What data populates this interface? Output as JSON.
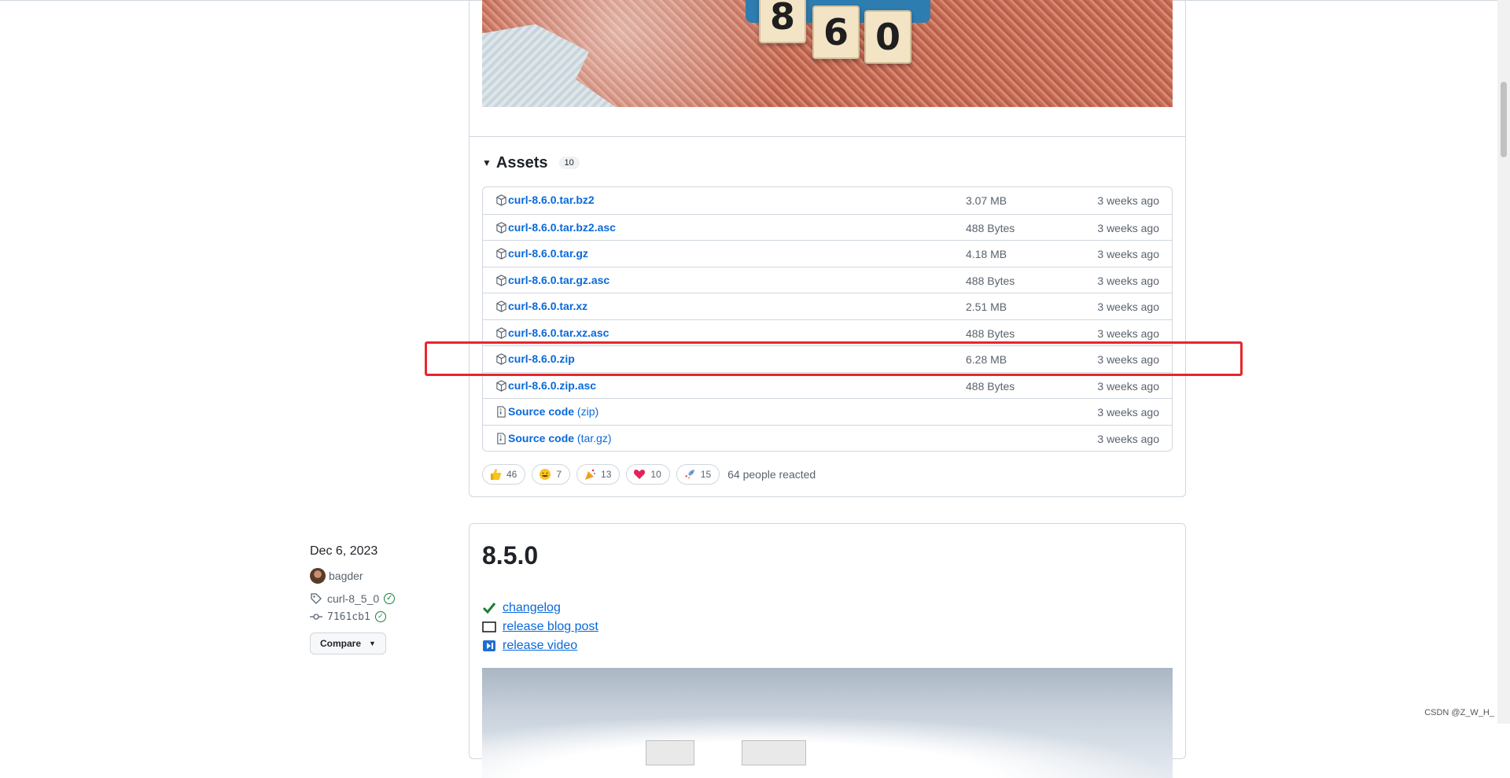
{
  "assets": {
    "title": "Assets",
    "count": "10",
    "items": [
      {
        "name": "curl-8.6.0.tar.bz2",
        "paren": "",
        "size": "3.07 MB",
        "date": "3 weeks ago",
        "icon": "package-icon"
      },
      {
        "name": "curl-8.6.0.tar.bz2.asc",
        "paren": "",
        "size": "488 Bytes",
        "date": "3 weeks ago",
        "icon": "package-icon"
      },
      {
        "name": "curl-8.6.0.tar.gz",
        "paren": "",
        "size": "4.18 MB",
        "date": "3 weeks ago",
        "icon": "package-icon"
      },
      {
        "name": "curl-8.6.0.tar.gz.asc",
        "paren": "",
        "size": "488 Bytes",
        "date": "3 weeks ago",
        "icon": "package-icon"
      },
      {
        "name": "curl-8.6.0.tar.xz",
        "paren": "",
        "size": "2.51 MB",
        "date": "3 weeks ago",
        "icon": "package-icon"
      },
      {
        "name": "curl-8.6.0.tar.xz.asc",
        "paren": "",
        "size": "488 Bytes",
        "date": "3 weeks ago",
        "icon": "package-icon"
      },
      {
        "name": "curl-8.6.0.zip",
        "paren": "",
        "size": "6.28 MB",
        "date": "3 weeks ago",
        "icon": "package-icon"
      },
      {
        "name": "curl-8.6.0.zip.asc",
        "paren": "",
        "size": "488 Bytes",
        "date": "3 weeks ago",
        "icon": "package-icon"
      },
      {
        "name": "Source code",
        "paren": "(zip)",
        "size": "",
        "date": "3 weeks ago",
        "icon": "file-zip-icon"
      },
      {
        "name": "Source code",
        "paren": "(tar.gz)",
        "size": "",
        "date": "3 weeks ago",
        "icon": "file-zip-icon"
      }
    ]
  },
  "reactions": {
    "items": [
      {
        "emoji": "thumbs-up-icon",
        "count": "46"
      },
      {
        "emoji": "laugh-icon",
        "count": "7"
      },
      {
        "emoji": "hooray-icon",
        "count": "13"
      },
      {
        "emoji": "heart-icon",
        "count": "10"
      },
      {
        "emoji": "rocket-icon",
        "count": "15"
      }
    ],
    "summary": "64 people reacted"
  },
  "hero1": {
    "tiles": [
      "8",
      "6",
      "0"
    ]
  },
  "release2": {
    "date": "Dec 6, 2023",
    "author": "bagder",
    "tag": "curl-8_5_0",
    "commit": "7161cb1",
    "compare_label": "Compare",
    "title": "8.5.0",
    "links": [
      {
        "icon": "check-mark-icon",
        "label": "changelog"
      },
      {
        "icon": "book-icon",
        "label": "release blog post"
      },
      {
        "icon": "play-video-icon",
        "label": "release video"
      }
    ]
  },
  "colors": {
    "accent": "#0969da",
    "highlight": "#e8262b",
    "success": "#1a7f37"
  },
  "watermark": "CSDN @Z_W_H_"
}
